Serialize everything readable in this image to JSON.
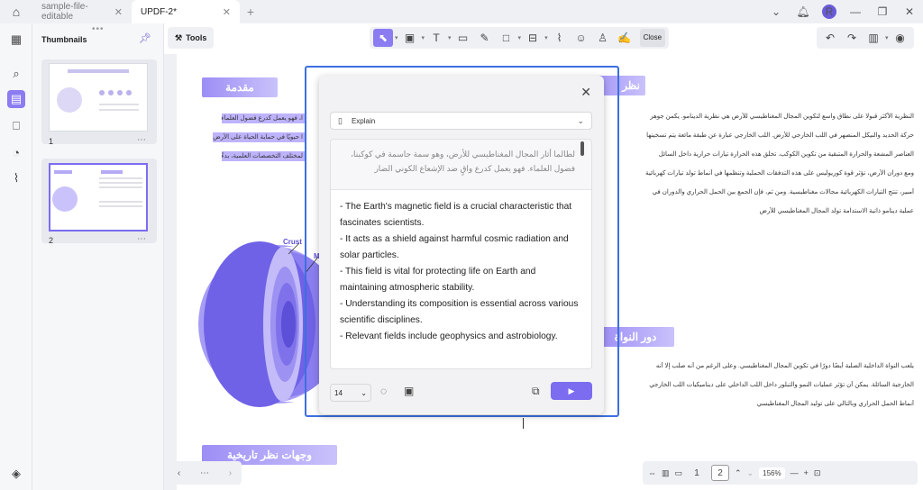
{
  "titlebar": {
    "tabs": [
      {
        "label": "sample-file-editable",
        "active": false
      },
      {
        "label": "UPDF-2*",
        "active": true
      }
    ],
    "avatar_initial": "R"
  },
  "thumbnails": {
    "header": "Thumbnails",
    "pages": [
      {
        "number": "1",
        "selected": false
      },
      {
        "number": "2",
        "selected": true
      }
    ]
  },
  "toolbar": {
    "tools_label": "Tools",
    "close_label": "Close"
  },
  "document": {
    "headings": {
      "intro": "مقدمة",
      "mid_right": "دور النواة",
      "bottom_left": "وجهات نظر تاريخية"
    },
    "diagram_labels": {
      "crust": "Crust",
      "mantle_initial": "M"
    },
    "right_column_lines": [
      "النظرية الأكثر قبولا على نطاق واسع لتكوين المجال المغناطيسي للأرض هي نظرية الدينامو. يكمن جوهر",
      "حركة الحديد والنيكل المنصهر في اللب الخارجي للأرض. اللب الخارجي عبارة عن طبقة مائعة يتم تسخينها",
      "العناصر المشعة والحرارة المتبقية من تكوين الكوكب. تخلق هذه الحرارة تيارات حرارية داخل السائل",
      "ومع دوران الأرض، تؤثر قوة كوريوليس على هذه التدفقات الحملية وتنظمها في أنماط تولد تيارات كهربائية",
      "أمبير، تنتج التيارات الكهربائية مجالات مغناطيسية. ومن ثم، فإن الجمع بين الحمل الحراري والدوران في",
      "عملية دينامو ذاتية الاستدامة تولد المجال المغناطيسي للأرض"
    ],
    "left_column_lines": [
      "ا، فهو يعمل كدرع فضول العلماء",
      "ا حيويًا في حماية الحياة على الأرض",
      "لمختلف التخصصات العلمية، بدءً"
    ],
    "lower_right_lines": [
      "يلعب النواة الداخلية الصلبة أيضًا دورًا في تكوين المجال المغناطيسي. وعلى الرغم من أنه صلب إلا أنه",
      "الخارجية السائلة. يمكن أن تؤثر عمليات النمو والتبلور داخل اللب الداخلي على ديناميكيات اللب الخارجي",
      "أنماط الحمل الحراري وبالتالي على توليد المجال المغناطيسي"
    ]
  },
  "ai_dialog": {
    "mode": "Explain",
    "source_text": "لطالما أثار المجال المغناطيسي للأرض، وهو سمة جاسمة في كوكبنا، فضول العلماء. فهو يعمل كدرع واقٍ ضد الإشعاع الكوني الضار",
    "bullets": [
      "- The Earth's magnetic field is a crucial characteristic that fascinates scientists.",
      "- It acts as a shield against harmful cosmic radiation and solar particles.",
      "- This field is vital for protecting life on Earth and maintaining atmospheric stability.",
      "- Understanding its composition is essential across various scientific disciplines.",
      "- Relevant fields include geophysics and astrobiology."
    ],
    "font_size": "14"
  },
  "statusbar": {
    "pages": [
      "1",
      "2"
    ],
    "current_page": "2",
    "zoom": "156%"
  }
}
